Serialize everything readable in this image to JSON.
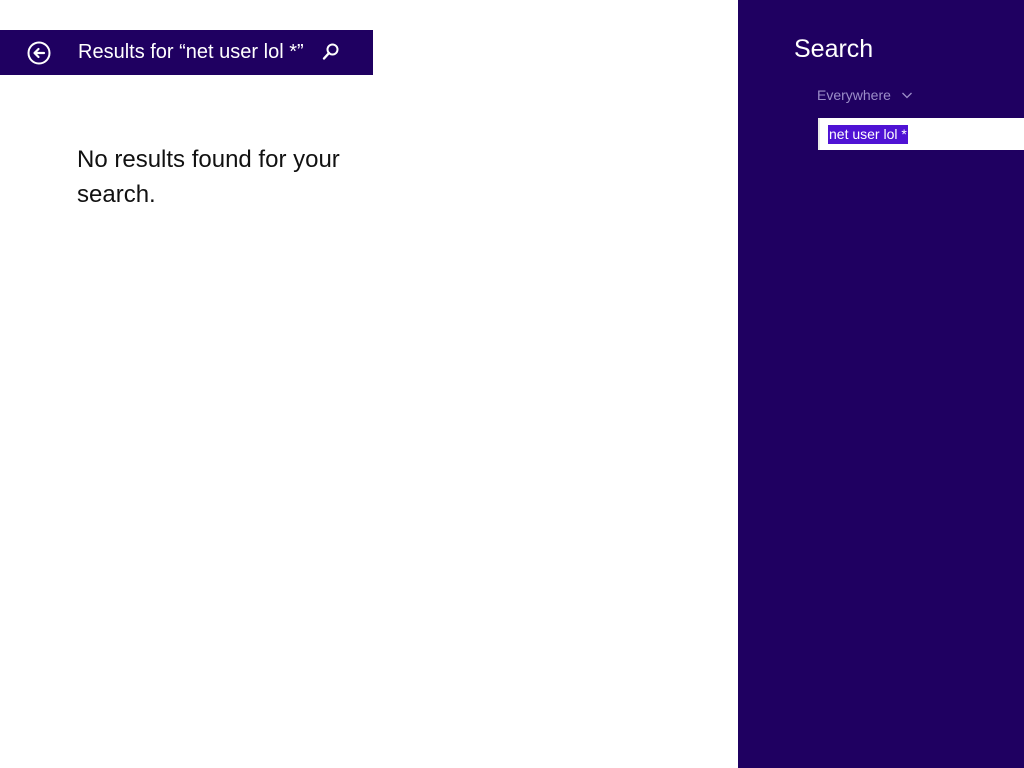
{
  "results_header": {
    "title": "Results for “net user lol *”",
    "back_icon": "back-arrow-icon",
    "search_icon": "search-icon"
  },
  "main": {
    "message": "No results found for your search."
  },
  "charm": {
    "title": "Search",
    "scope": {
      "selected": "Everywhere",
      "icon": "chevron-down-icon"
    },
    "search_box": {
      "value": "net user lol *"
    }
  },
  "colors": {
    "accent": "#1f0061",
    "selection": "#4f12d4",
    "scope_text": "#9c8ec9"
  }
}
